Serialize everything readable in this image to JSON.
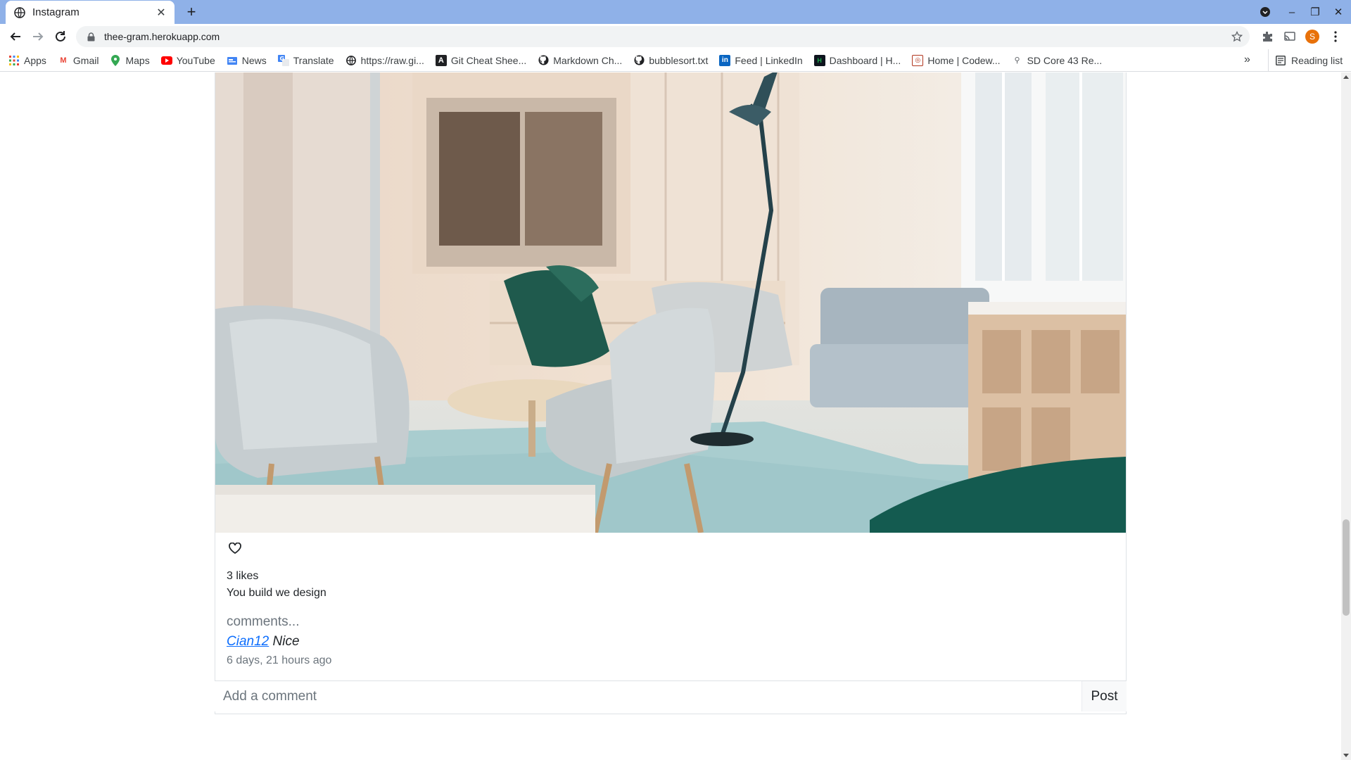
{
  "browser": {
    "tab_title": "Instagram",
    "url": "thee-gram.herokuapp.com",
    "profile_initial": "S",
    "bookmarks": [
      {
        "label": "Apps",
        "icon": "apps-grid-icon",
        "color": "#ea4335"
      },
      {
        "label": "Gmail",
        "icon": "gmail-icon",
        "color": "#ea4335"
      },
      {
        "label": "Maps",
        "icon": "maps-icon",
        "color": "#34a853"
      },
      {
        "label": "YouTube",
        "icon": "youtube-icon",
        "color": "#ff0000"
      },
      {
        "label": "News",
        "icon": "news-icon",
        "color": "#4285f4"
      },
      {
        "label": "Translate",
        "icon": "translate-icon",
        "color": "#4285f4"
      },
      {
        "label": "https://raw.gi...",
        "icon": "globe-icon",
        "color": "#202124"
      },
      {
        "label": "Git Cheat Shee...",
        "icon": "atlassian-icon",
        "color": "#202124"
      },
      {
        "label": "Markdown Ch...",
        "icon": "github-icon",
        "color": "#202124"
      },
      {
        "label": "bubblesort.txt",
        "icon": "github-icon",
        "color": "#202124"
      },
      {
        "label": "Feed | LinkedIn",
        "icon": "linkedin-icon",
        "color": "#0a66c2"
      },
      {
        "label": "Dashboard | H...",
        "icon": "hackerrank-icon",
        "color": "#1ba94c"
      },
      {
        "label": "Home | Codew...",
        "icon": "codewars-icon",
        "color": "#b1361e"
      },
      {
        "label": "SD Core 43 Re...",
        "icon": "pin-icon",
        "color": "#5f6368"
      }
    ],
    "bookmarks_overflow": "»",
    "reading_list": "Reading list"
  },
  "post": {
    "likes_text": "3 likes",
    "caption": "You build we design",
    "comments_label": "comments...",
    "comments": [
      {
        "user": "Cian12",
        "text": "Nice"
      }
    ],
    "timestamp": "6 days, 21 hours ago",
    "comment_placeholder": "Add a comment",
    "post_button": "Post"
  }
}
